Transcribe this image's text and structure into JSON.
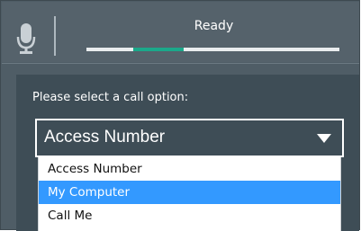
{
  "header": {
    "mic_icon": "microphone-icon",
    "status": "Ready",
    "colors": {
      "bar_bg": "#55626b",
      "progress_accent": "#1ba88a"
    }
  },
  "call_options": {
    "prompt": "Please select a call option:",
    "selected_value": "Access Number",
    "caret_icon": "chevron-down-icon",
    "options": [
      {
        "label": "Access Number",
        "highlighted": false
      },
      {
        "label": "My Computer",
        "highlighted": true
      },
      {
        "label": "Call Me",
        "highlighted": false
      }
    ],
    "colors": {
      "highlight": "#3399ff",
      "card_bg": "#3e4d56"
    }
  }
}
